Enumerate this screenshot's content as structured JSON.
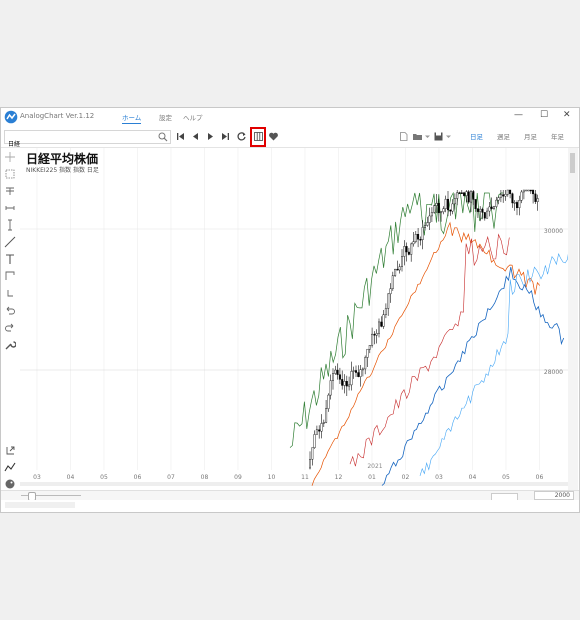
{
  "app": {
    "title": "AnalogChart Ver.1.12"
  },
  "menu": [
    {
      "label": "ホーム",
      "active": true
    },
    {
      "label": "設定",
      "active": false
    },
    {
      "label": "ヘルプ",
      "active": false
    }
  ],
  "window_controls": {
    "minimize": "—",
    "maximize": "☐",
    "close": "✕"
  },
  "toolbar": {
    "search_value": "日経",
    "period_tabs": [
      {
        "label": "日足",
        "active": true
      },
      {
        "label": "週足",
        "active": false
      },
      {
        "label": "月足",
        "active": false
      },
      {
        "label": "年足",
        "active": false
      }
    ]
  },
  "chart": {
    "title": "日経平均株価",
    "subtitle": "NIKKEI225 指数 指数  日足",
    "price_labels": [
      "30000",
      "28000"
    ],
    "year_label": "2021",
    "month_labels": [
      "03",
      "04",
      "05",
      "06",
      "07",
      "08",
      "09",
      "10",
      "11",
      "12",
      "01",
      "02",
      "03",
      "04",
      "05",
      "06"
    ],
    "zoom_value": "2000"
  },
  "colors": {
    "accent": "#2a7fd4",
    "highlight": "#e00000"
  }
}
